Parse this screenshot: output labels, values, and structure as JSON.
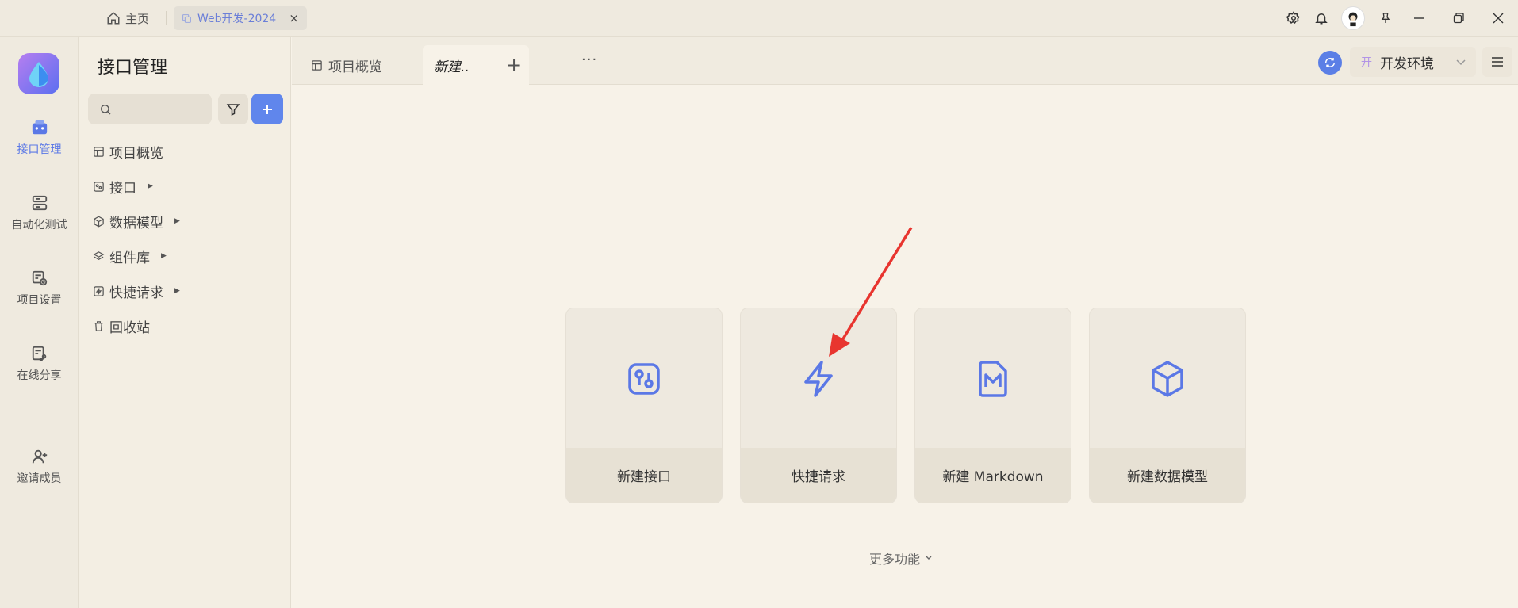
{
  "titlebar": {
    "home_label": "主页",
    "workspace_tab": "Web开发-2024",
    "close_symbol": "×"
  },
  "rail": {
    "items": [
      {
        "label": "接口管理",
        "icon": "api-icon"
      },
      {
        "label": "自动化测试",
        "icon": "automation-icon"
      },
      {
        "label": "项目设置",
        "icon": "project-settings-icon"
      },
      {
        "label": "在线分享",
        "icon": "share-icon"
      },
      {
        "label": "邀请成员",
        "icon": "invite-member-icon"
      }
    ]
  },
  "sidebar": {
    "title": "接口管理",
    "search_placeholder": "",
    "nav": [
      {
        "label": "项目概览"
      },
      {
        "label": "接口"
      },
      {
        "label": "数据模型"
      },
      {
        "label": "组件库"
      },
      {
        "label": "快捷请求"
      },
      {
        "label": "回收站"
      }
    ]
  },
  "tabs": {
    "overview": "项目概览",
    "new": "新建..",
    "add_symbol": "+",
    "more_symbol": "···"
  },
  "env": {
    "badge": "开",
    "name": "开发环境"
  },
  "cards": [
    {
      "label": "新建接口",
      "icon": "api-icon"
    },
    {
      "label": "快捷请求",
      "icon": "lightning-icon"
    },
    {
      "label": "新建 Markdown",
      "icon": "markdown-icon"
    },
    {
      "label": "新建数据模型",
      "icon": "cube-icon"
    }
  ],
  "more_functions": "更多功能",
  "colors": {
    "accent": "#5b78e6",
    "background": "#f7f2e8",
    "arrow": "#e8352f"
  }
}
